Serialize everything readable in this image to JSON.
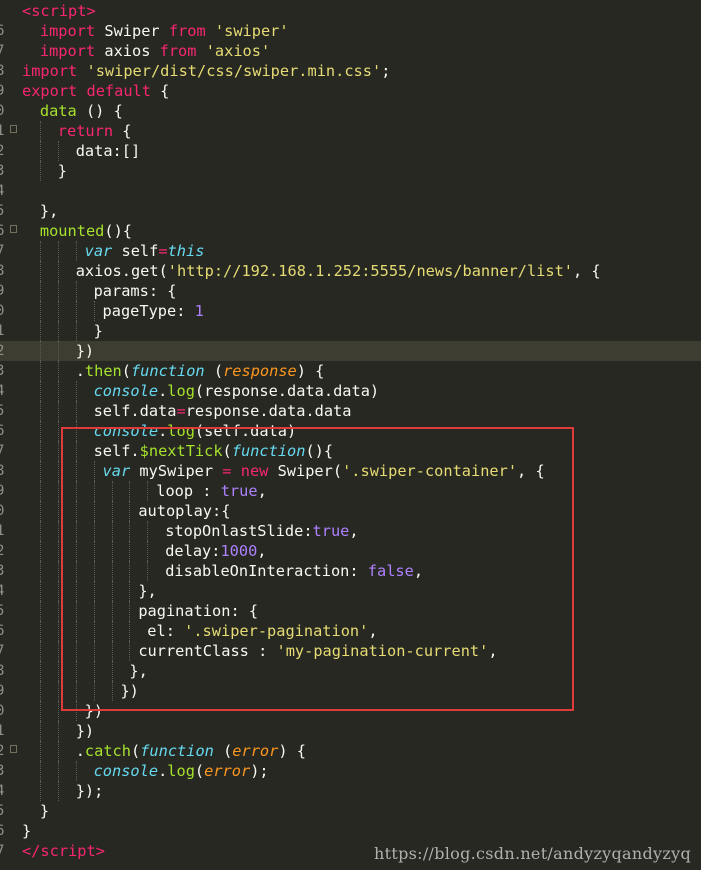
{
  "colors": {
    "background": "#272822",
    "highlight_line": "#3e3d32",
    "keyword": "#f92672",
    "string": "#e6db74",
    "function": "#a6e22e",
    "italic_keyword": "#66d9ef",
    "number": "#ae81ff",
    "parameter": "#fd971f",
    "plain": "#f8f8f2",
    "annotation_box": "#e03b3b"
  },
  "watermark": "https://blog.csdn.net/andyzyqandyzyq",
  "lines": [
    {
      "gutter": "",
      "indent": 0,
      "hl": false,
      "fold": false,
      "tokens": [
        [
          "t-tag",
          "<"
        ],
        [
          "t-tag",
          "script"
        ],
        [
          "t-tag",
          ">"
        ]
      ]
    },
    {
      "gutter": "6",
      "indent": 2,
      "hl": false,
      "fold": false,
      "tokens": [
        [
          "t-kw",
          "import"
        ],
        [
          "t-pl",
          " Swiper "
        ],
        [
          "t-kw",
          "from"
        ],
        [
          "t-pl",
          " "
        ],
        [
          "t-str",
          "'swiper'"
        ]
      ]
    },
    {
      "gutter": "7",
      "indent": 2,
      "hl": false,
      "fold": false,
      "tokens": [
        [
          "t-kw",
          "import"
        ],
        [
          "t-pl",
          " axios "
        ],
        [
          "t-kw",
          "from"
        ],
        [
          "t-pl",
          " "
        ],
        [
          "t-str",
          "'axios'"
        ]
      ]
    },
    {
      "gutter": "8",
      "indent": 0,
      "hl": false,
      "fold": false,
      "tokens": [
        [
          "t-kw",
          "import"
        ],
        [
          "t-pl",
          " "
        ],
        [
          "t-str",
          "'swiper/dist/css/swiper.min.css'"
        ],
        [
          "t-pl",
          ";"
        ]
      ]
    },
    {
      "gutter": "9",
      "indent": 0,
      "hl": false,
      "fold": false,
      "tokens": [
        [
          "t-kw",
          "export"
        ],
        [
          "t-pl",
          " "
        ],
        [
          "t-kw",
          "default"
        ],
        [
          "t-pl",
          " {"
        ]
      ]
    },
    {
      "gutter": "0",
      "indent": 2,
      "hl": false,
      "fold": false,
      "tokens": [
        [
          "t-fn",
          "data"
        ],
        [
          "t-pl",
          " () {"
        ]
      ]
    },
    {
      "gutter": "1",
      "indent": 4,
      "hl": false,
      "fold": true,
      "tokens": [
        [
          "t-kw",
          "return"
        ],
        [
          "t-pl",
          " {"
        ]
      ]
    },
    {
      "gutter": "2",
      "indent": 6,
      "hl": false,
      "fold": false,
      "tokens": [
        [
          "t-pl",
          "data:[]"
        ]
      ]
    },
    {
      "gutter": "3",
      "indent": 4,
      "hl": false,
      "fold": false,
      "tokens": [
        [
          "t-pl",
          "}"
        ]
      ]
    },
    {
      "gutter": "4",
      "indent": 0,
      "hl": false,
      "fold": false,
      "tokens": []
    },
    {
      "gutter": "5",
      "indent": 2,
      "hl": false,
      "fold": false,
      "tokens": [
        [
          "t-pl",
          "},"
        ]
      ]
    },
    {
      "gutter": "6",
      "indent": 2,
      "hl": false,
      "fold": true,
      "tokens": [
        [
          "t-fn",
          "mounted"
        ],
        [
          "t-pl",
          "(){"
        ]
      ]
    },
    {
      "gutter": "7",
      "indent": 7,
      "hl": false,
      "fold": false,
      "tokens": [
        [
          "t-it",
          "var"
        ],
        [
          "t-pl",
          " self"
        ],
        [
          "t-kw",
          "="
        ],
        [
          "t-it",
          "this"
        ]
      ]
    },
    {
      "gutter": "8",
      "indent": 6,
      "hl": false,
      "fold": false,
      "tokens": [
        [
          "t-pl",
          "axios.get("
        ],
        [
          "t-str",
          "'http://192.168.1.252:5555/news/banner/list'"
        ],
        [
          "t-pl",
          ", {"
        ]
      ]
    },
    {
      "gutter": "9",
      "indent": 8,
      "hl": false,
      "fold": false,
      "tokens": [
        [
          "t-pl",
          "params: {"
        ]
      ]
    },
    {
      "gutter": "0",
      "indent": 9,
      "hl": false,
      "fold": false,
      "tokens": [
        [
          "t-pl",
          "pageType: "
        ],
        [
          "t-num",
          "1"
        ]
      ]
    },
    {
      "gutter": "1",
      "indent": 8,
      "hl": false,
      "fold": false,
      "tokens": [
        [
          "t-pl",
          "}"
        ]
      ]
    },
    {
      "gutter": "2",
      "indent": 6,
      "hl": true,
      "fold": false,
      "tokens": [
        [
          "t-pl",
          "})"
        ]
      ]
    },
    {
      "gutter": "3",
      "indent": 6,
      "hl": false,
      "fold": false,
      "tokens": [
        [
          "t-pl",
          "."
        ],
        [
          "t-fn",
          "then"
        ],
        [
          "t-pl",
          "("
        ],
        [
          "t-it",
          "function"
        ],
        [
          "t-pl",
          " ("
        ],
        [
          "t-par",
          "response"
        ],
        [
          "t-pl",
          ") {"
        ]
      ]
    },
    {
      "gutter": "4",
      "indent": 8,
      "hl": false,
      "fold": false,
      "tokens": [
        [
          "t-it",
          "console"
        ],
        [
          "t-pl",
          "."
        ],
        [
          "t-fn",
          "log"
        ],
        [
          "t-pl",
          "(response.data.data)"
        ]
      ]
    },
    {
      "gutter": "5",
      "indent": 8,
      "hl": false,
      "fold": false,
      "tokens": [
        [
          "t-pl",
          "self.data"
        ],
        [
          "t-kw",
          "="
        ],
        [
          "t-pl",
          "response.data.data"
        ]
      ]
    },
    {
      "gutter": "6",
      "indent": 8,
      "hl": false,
      "fold": false,
      "tokens": [
        [
          "t-it",
          "console"
        ],
        [
          "t-pl",
          "."
        ],
        [
          "t-fn",
          "log"
        ],
        [
          "t-pl",
          "(self.data)"
        ]
      ]
    },
    {
      "gutter": "7",
      "indent": 8,
      "hl": false,
      "fold": false,
      "tokens": [
        [
          "t-pl",
          "self."
        ],
        [
          "t-fn",
          "$nextTick"
        ],
        [
          "t-pl",
          "("
        ],
        [
          "t-it",
          "function"
        ],
        [
          "t-pl",
          "(){"
        ]
      ]
    },
    {
      "gutter": "8",
      "indent": 9,
      "hl": false,
      "fold": false,
      "tokens": [
        [
          "t-it",
          "var"
        ],
        [
          "t-pl",
          " mySwiper "
        ],
        [
          "t-kw",
          "="
        ],
        [
          "t-pl",
          " "
        ],
        [
          "t-kw",
          "new"
        ],
        [
          "t-pl",
          " Swiper("
        ],
        [
          "t-str",
          "'.swiper-container'"
        ],
        [
          "t-pl",
          ", {"
        ]
      ]
    },
    {
      "gutter": "9",
      "indent": 15,
      "hl": false,
      "fold": false,
      "tokens": [
        [
          "t-pl",
          "loop : "
        ],
        [
          "t-num",
          "true"
        ],
        [
          "t-pl",
          ","
        ]
      ]
    },
    {
      "gutter": "0",
      "indent": 13,
      "hl": false,
      "fold": false,
      "tokens": [
        [
          "t-pl",
          "autoplay:{"
        ]
      ]
    },
    {
      "gutter": "1",
      "indent": 16,
      "hl": false,
      "fold": false,
      "tokens": [
        [
          "t-pl",
          "stopOnlastSlide:"
        ],
        [
          "t-num",
          "true"
        ],
        [
          "t-pl",
          ","
        ]
      ]
    },
    {
      "gutter": "2",
      "indent": 16,
      "hl": false,
      "fold": false,
      "tokens": [
        [
          "t-pl",
          "delay:"
        ],
        [
          "t-num",
          "1000"
        ],
        [
          "t-pl",
          ","
        ]
      ]
    },
    {
      "gutter": "3",
      "indent": 16,
      "hl": false,
      "fold": false,
      "tokens": [
        [
          "t-pl",
          "disableOnInteraction: "
        ],
        [
          "t-num",
          "false"
        ],
        [
          "t-pl",
          ","
        ]
      ]
    },
    {
      "gutter": "4",
      "indent": 13,
      "hl": false,
      "fold": false,
      "tokens": [
        [
          "t-pl",
          "},"
        ]
      ]
    },
    {
      "gutter": "5",
      "indent": 13,
      "hl": false,
      "fold": false,
      "tokens": [
        [
          "t-pl",
          "pagination: {"
        ]
      ]
    },
    {
      "gutter": "6",
      "indent": 14,
      "hl": false,
      "fold": false,
      "tokens": [
        [
          "t-pl",
          "el: "
        ],
        [
          "t-str",
          "'.swiper-pagination'"
        ],
        [
          "t-pl",
          ","
        ]
      ]
    },
    {
      "gutter": "7",
      "indent": 13,
      "hl": false,
      "fold": false,
      "tokens": [
        [
          "t-pl",
          "currentClass : "
        ],
        [
          "t-str",
          "'my-pagination-current'"
        ],
        [
          "t-pl",
          ","
        ]
      ]
    },
    {
      "gutter": "8",
      "indent": 12,
      "hl": false,
      "fold": false,
      "tokens": [
        [
          "t-pl",
          "},"
        ]
      ]
    },
    {
      "gutter": "9",
      "indent": 11,
      "hl": false,
      "fold": false,
      "tokens": [
        [
          "t-pl",
          "})"
        ]
      ]
    },
    {
      "gutter": "0",
      "indent": 7,
      "hl": false,
      "fold": false,
      "tokens": [
        [
          "t-pl",
          "})"
        ]
      ]
    },
    {
      "gutter": "1",
      "indent": 6,
      "hl": false,
      "fold": false,
      "tokens": [
        [
          "t-pl",
          "})"
        ]
      ]
    },
    {
      "gutter": "2",
      "indent": 6,
      "hl": false,
      "fold": true,
      "tokens": [
        [
          "t-pl",
          "."
        ],
        [
          "t-fn",
          "catch"
        ],
        [
          "t-pl",
          "("
        ],
        [
          "t-it",
          "function"
        ],
        [
          "t-pl",
          " ("
        ],
        [
          "t-par",
          "error"
        ],
        [
          "t-pl",
          ") {"
        ]
      ]
    },
    {
      "gutter": "3",
      "indent": 8,
      "hl": false,
      "fold": false,
      "tokens": [
        [
          "t-it",
          "console"
        ],
        [
          "t-pl",
          "."
        ],
        [
          "t-fn",
          "log"
        ],
        [
          "t-pl",
          "("
        ],
        [
          "t-par",
          "error"
        ],
        [
          "t-pl",
          ");"
        ]
      ]
    },
    {
      "gutter": "4",
      "indent": 6,
      "hl": false,
      "fold": false,
      "tokens": [
        [
          "t-pl",
          "});"
        ]
      ]
    },
    {
      "gutter": "5",
      "indent": 2,
      "hl": false,
      "fold": false,
      "tokens": [
        [
          "t-pl",
          "}"
        ]
      ]
    },
    {
      "gutter": "6",
      "indent": 0,
      "hl": false,
      "fold": false,
      "tokens": [
        [
          "t-pl",
          "}"
        ]
      ]
    },
    {
      "gutter": "7",
      "indent": 0,
      "hl": false,
      "fold": false,
      "tokens": [
        [
          "t-tag",
          "</"
        ],
        [
          "t-tag",
          "script"
        ],
        [
          "t-tag",
          ">"
        ]
      ]
    }
  ]
}
